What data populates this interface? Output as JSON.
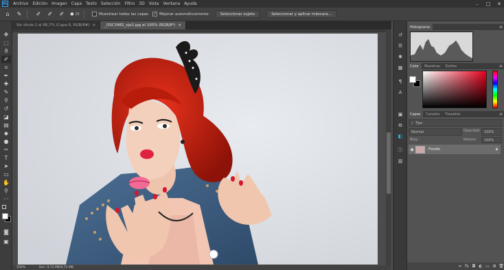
{
  "menubar": {
    "app_logo": "Ps",
    "items": [
      "Archivo",
      "Edición",
      "Imagen",
      "Capa",
      "Texto",
      "Selección",
      "Filtro",
      "3D",
      "Vista",
      "Ventana",
      "Ayuda"
    ],
    "window_controls": [
      "–",
      "□",
      "✕"
    ]
  },
  "options": {
    "brush_size": "15",
    "sample_all_layers_label": "Muestrear todas las capas",
    "sample_all_layers_checked": false,
    "auto_enhance_label": "Mejorar automáticamente",
    "auto_enhance_checked": true,
    "select_subject_button": "Seleccionar sujeto",
    "select_mask_button": "Seleccionar y aplicar máscara..."
  },
  "documents": {
    "tabs": [
      {
        "label": "Sin título-1 al 66,7% (Capa 6, RGB/8#)",
        "active": false
      },
      {
        "label": "_DSC3482_ojo2.jpg al 100% (RGB/8*)",
        "active": true
      }
    ],
    "close_glyph": "×"
  },
  "status": {
    "zoom": "100%",
    "doc_info": "Doc: 9,72 MB/9,72 MB"
  },
  "panels": {
    "histogram_tab": "Histograma",
    "color_tabs": [
      "Color",
      "Muestras",
      "Estilos"
    ],
    "layers_tabs": [
      "Capas",
      "Canales",
      "Trazados"
    ],
    "filter_label": "Tipo",
    "blend_mode": "Normal",
    "opacity_label": "Opacidad:",
    "opacity_value": "100%",
    "lock_label": "Bloq.:",
    "fill_label": "Relleno:",
    "fill_value": "100%",
    "layer_name": "Fondo"
  },
  "colors": {
    "foreground": "#ffffff",
    "background": "#000000",
    "accent": "#31a8ff"
  }
}
